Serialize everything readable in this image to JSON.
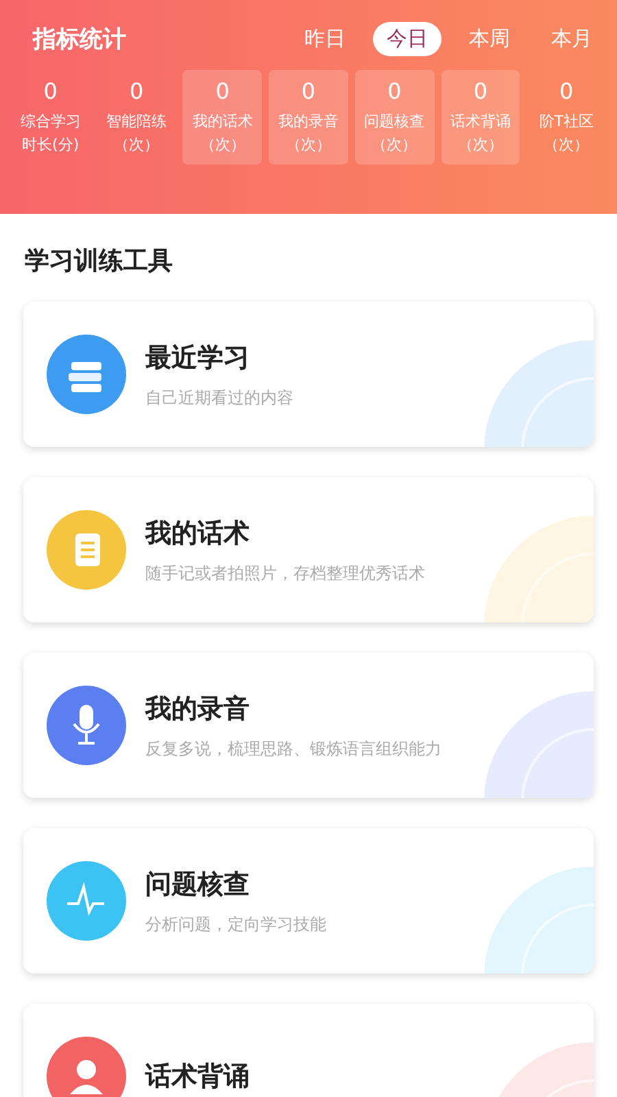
{
  "header": {
    "title": "指标统计",
    "periods": [
      {
        "label": "昨日",
        "selected": false
      },
      {
        "label": "今日",
        "selected": true
      },
      {
        "label": "本周",
        "selected": false
      },
      {
        "label": "本月",
        "selected": false
      }
    ],
    "stats": [
      {
        "value": "0",
        "label": "综合学习时长(分)",
        "highlighted": false
      },
      {
        "value": "0",
        "label": "智能陪练（次）",
        "highlighted": false
      },
      {
        "value": "0",
        "label": "我的话术（次）",
        "highlighted": true
      },
      {
        "value": "0",
        "label": "我的录音（次）",
        "highlighted": true
      },
      {
        "value": "0",
        "label": "问题核查（次）",
        "highlighted": true
      },
      {
        "value": "0",
        "label": "话术背诵（次）",
        "highlighted": true
      },
      {
        "value": "0",
        "label": "阶T社区（次）",
        "highlighted": false
      }
    ]
  },
  "section_title": "学习训练工具",
  "tools": [
    {
      "kind": "books",
      "title": "最近学习",
      "subtitle": "自己近期看过的内容",
      "color": "#3d9bf0"
    },
    {
      "kind": "notebook",
      "title": "我的话术",
      "subtitle": "随手记或者拍照片，存档整理优秀话术",
      "color": "#f5c53f"
    },
    {
      "kind": "microphone",
      "title": "我的录音",
      "subtitle": "反复多说，梳理思路、锻炼语言组织能力",
      "color": "#5b7ff0"
    },
    {
      "kind": "pulse",
      "title": "问题核查",
      "subtitle": "分析问题，定向学习技能",
      "color": "#3cc3f3"
    },
    {
      "kind": "person",
      "title": "话术背诵",
      "color": "#f26464"
    }
  ]
}
